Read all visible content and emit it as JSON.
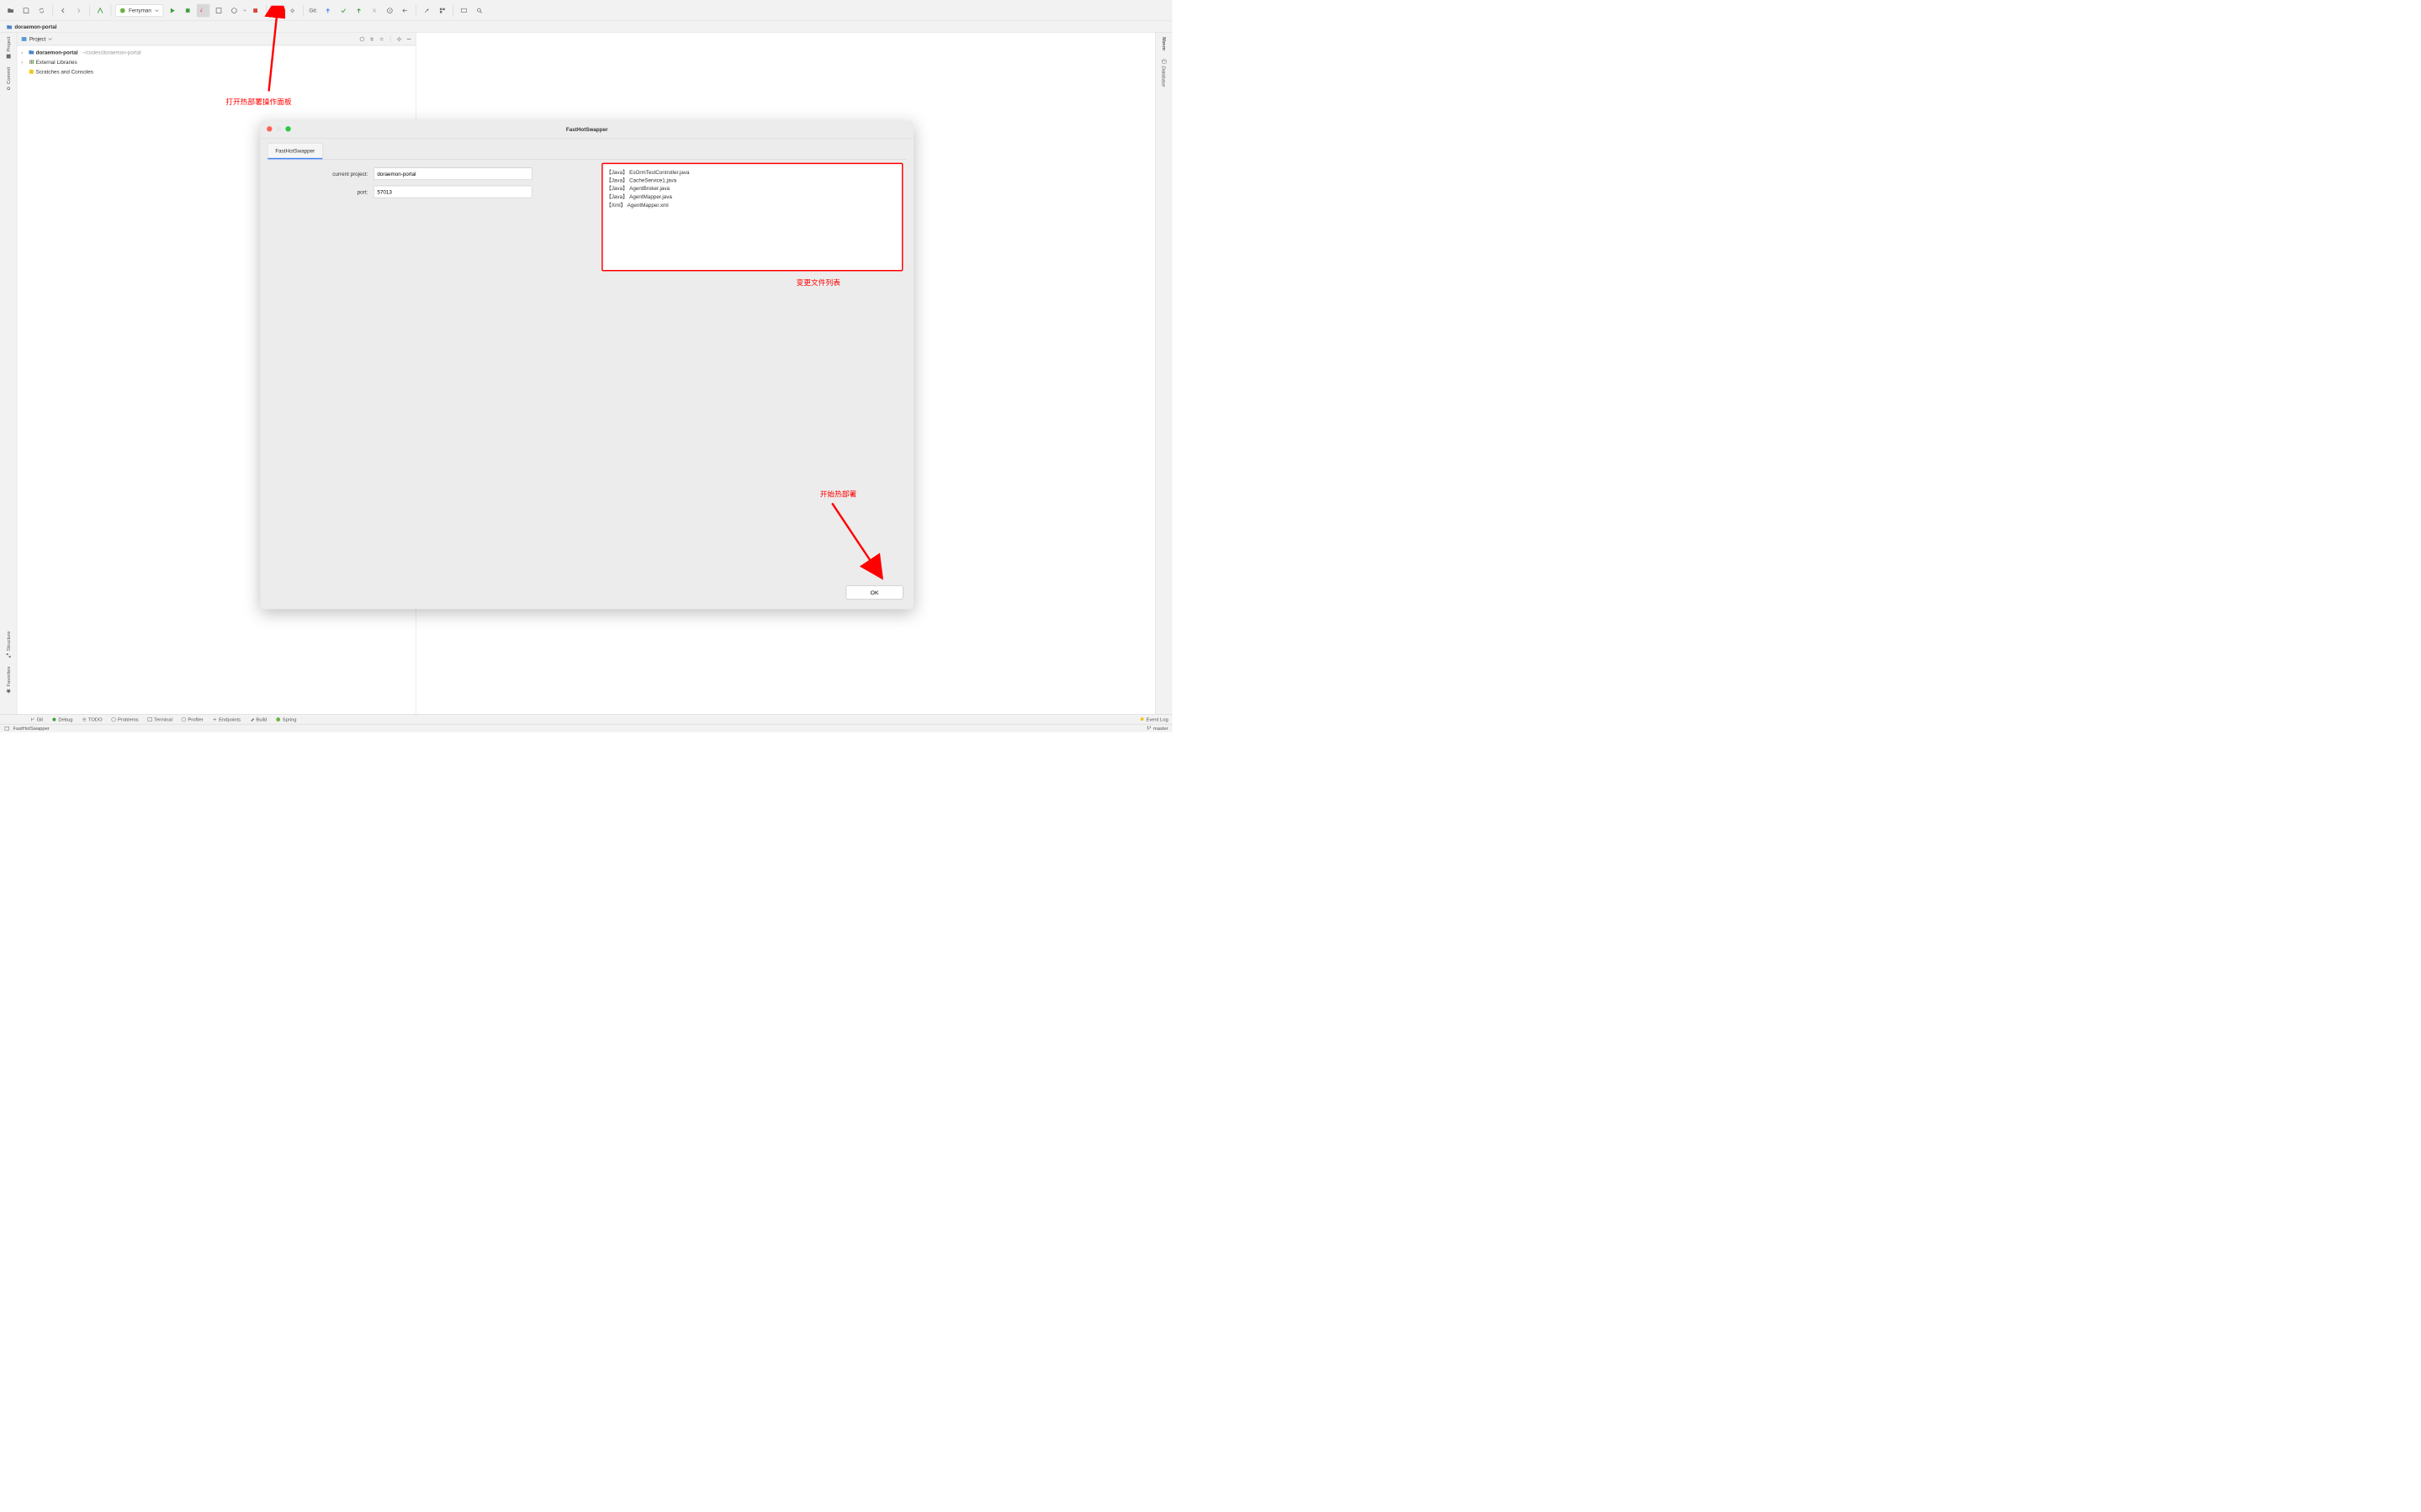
{
  "toolbar": {
    "run_config": "Ferryman",
    "git_label": "Git:"
  },
  "breadcrumb": {
    "project": "doraemon-portal"
  },
  "left_rail": {
    "project": "Project",
    "commit": "Commit"
  },
  "left_rail_bottom": {
    "structure": "Structure",
    "favorites": "Favorites"
  },
  "right_rail": {
    "maven": "Maven",
    "database": "Database"
  },
  "project_panel": {
    "title": "Project",
    "root": "doraemon-portal",
    "root_path": "~/codes/doraemon-portal",
    "external": "External Libraries",
    "scratches": "Scratches and Consoles"
  },
  "dialog": {
    "title": "FastHotSwapper",
    "tab": "FastHotSwapper",
    "label_project": "current project:",
    "label_port": "port:",
    "value_project": "doraemon-portal",
    "value_port": "57013",
    "ok": "OK",
    "files": [
      {
        "type": "【Java】",
        "name": "EsOrmTestController.java"
      },
      {
        "type": "【Java】",
        "name": "CacheService1.java"
      },
      {
        "type": "【Java】",
        "name": "AgentBroker.java"
      },
      {
        "type": "【Java】",
        "name": "AgentMapper.java"
      },
      {
        "type": "【Xml】",
        "name": "AgentMapper.xml"
      }
    ]
  },
  "annotations": {
    "open_panel": "打开热部署操作面板",
    "file_list": "变更文件列表",
    "start_deploy": "开始热部署"
  },
  "bottom_tabs": {
    "git": "Git",
    "debug": "Debug",
    "todo": "TODO",
    "problems": "Problems",
    "terminal": "Terminal",
    "profiler": "Profiler",
    "endpoints": "Endpoints",
    "build": "Build",
    "spring": "Spring",
    "event_log": "Event Log"
  },
  "status_bar": {
    "msg": "FastHotSwapper",
    "branch": "master"
  }
}
